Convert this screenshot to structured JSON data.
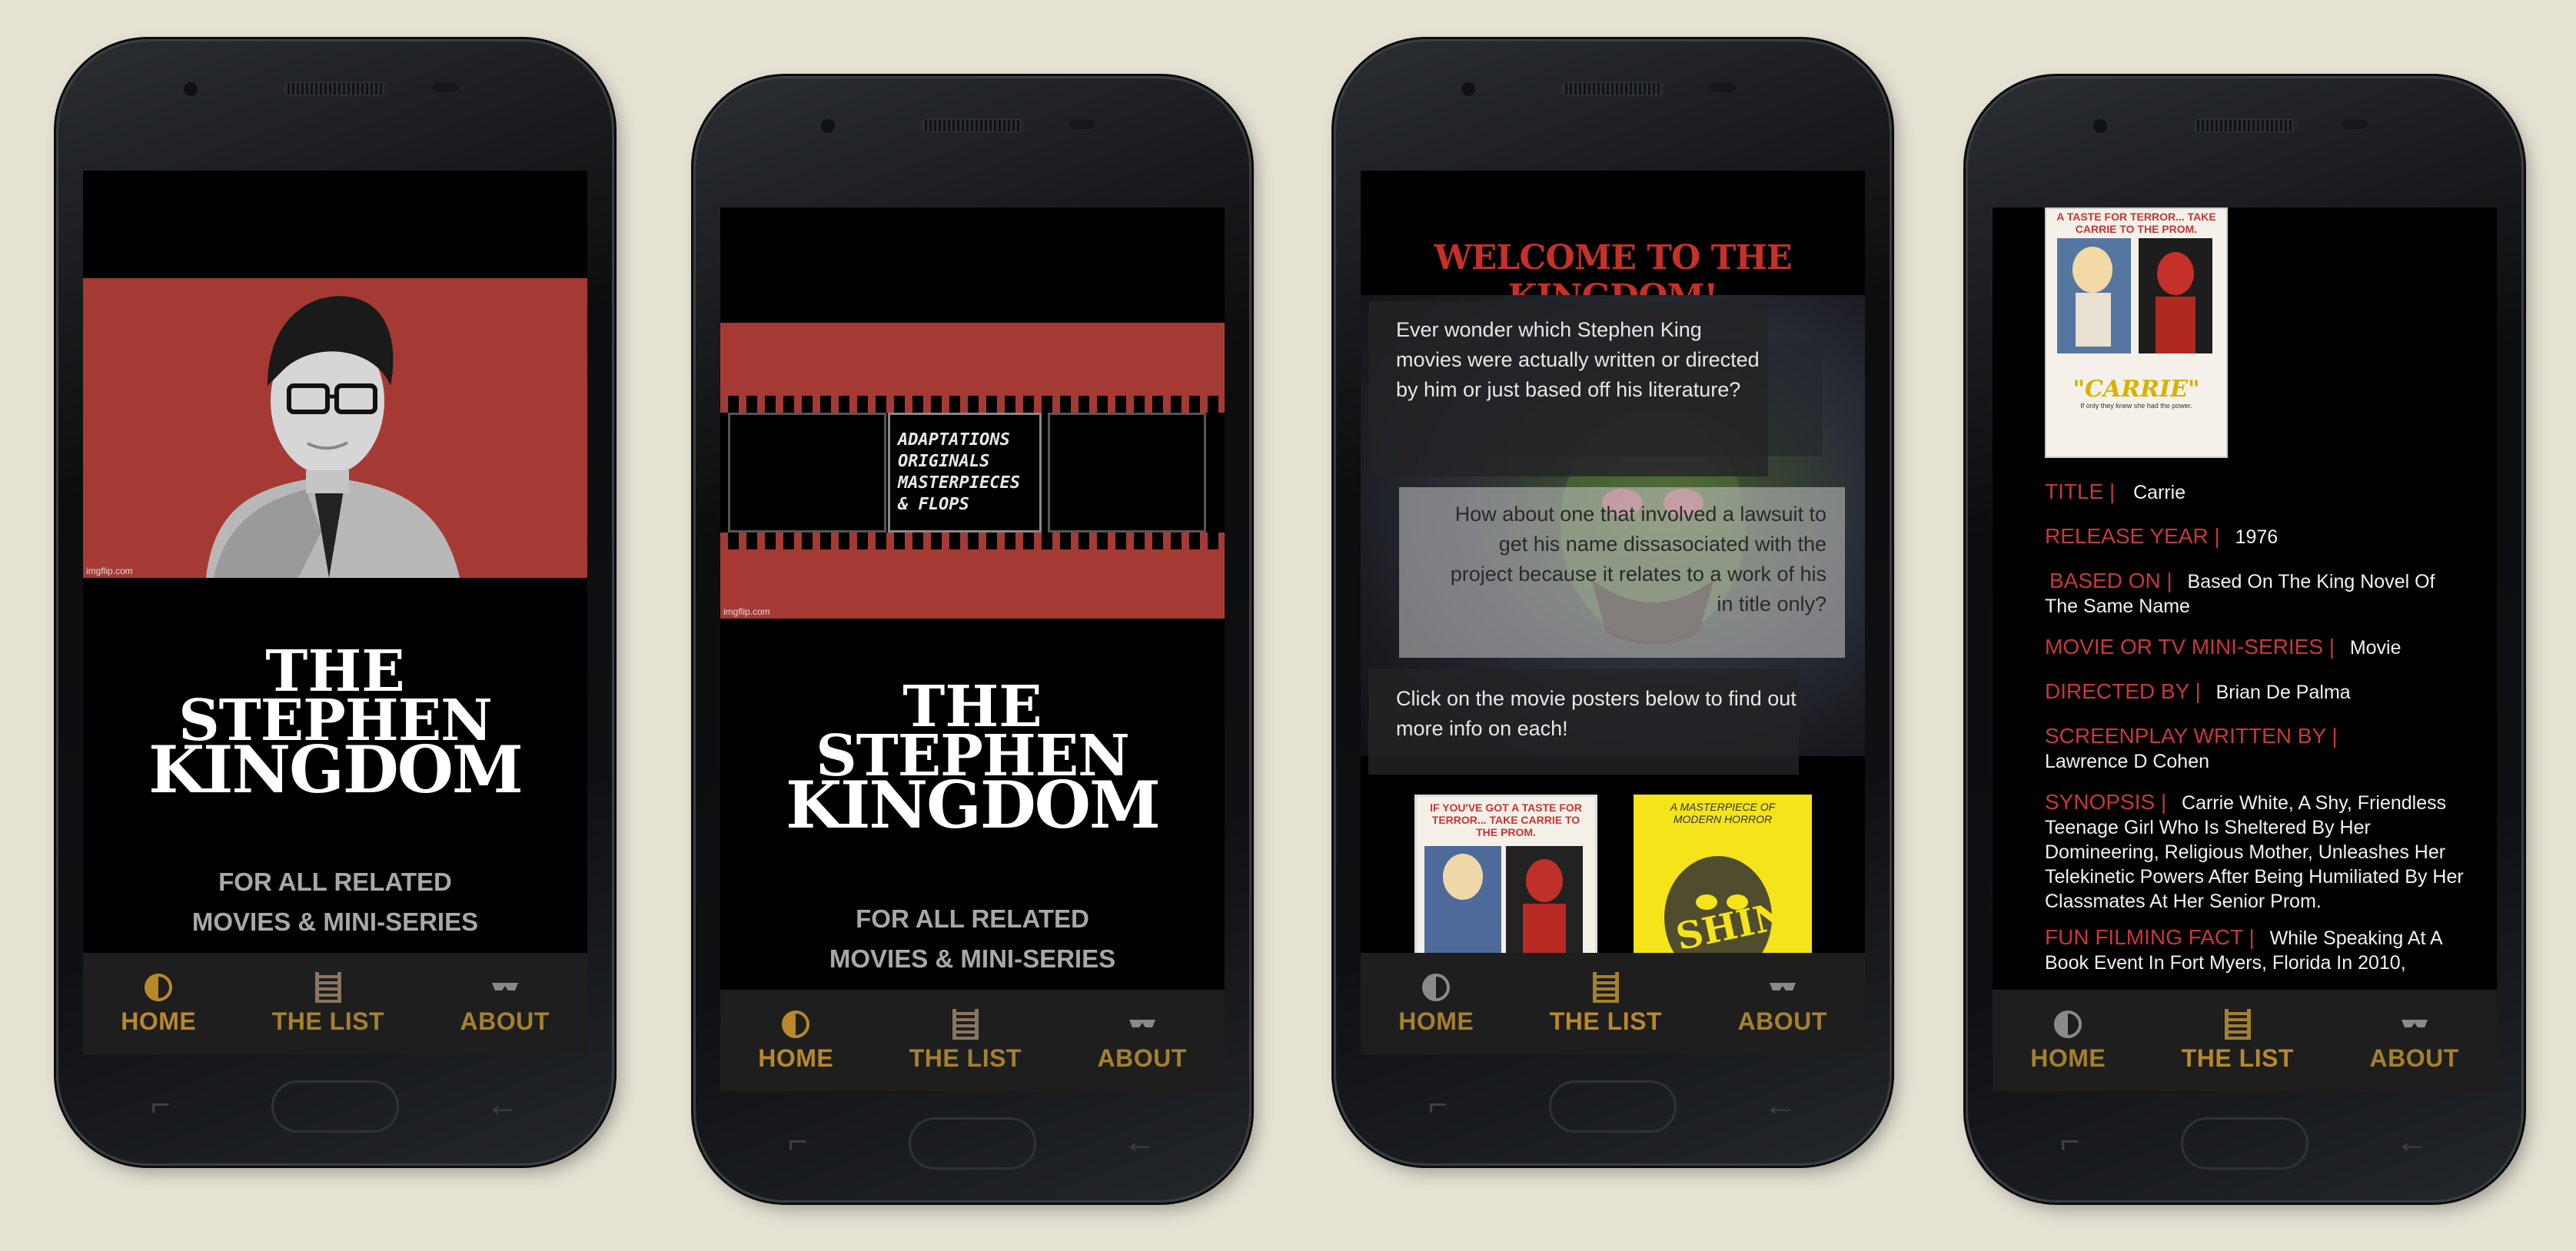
{
  "app": {
    "logo_line1": "THE",
    "logo_line2": "STEPHEN",
    "logo_line3": "KINGDOM",
    "tagline_line1": "FOR ALL RELATED",
    "tagline_line2": "MOVIES & MINI-SERIES",
    "credit": "imgflip.com",
    "accent_color": "#a4812e",
    "brand_red": "#a53a35"
  },
  "tabs": [
    {
      "label": "HOME",
      "icon": "half-circle-icon"
    },
    {
      "label": "THE LIST",
      "icon": "film-icon"
    },
    {
      "label": "ABOUT",
      "icon": "sunglasses-icon"
    }
  ],
  "screen2": {
    "filmstrip_lines": [
      "ADAPTATIONS",
      "ORIGINALS",
      "MASTERPIECES",
      "& FLOPS"
    ]
  },
  "screen3": {
    "welcome": "WELCOME TO THE KINGDOM!",
    "intro": "Ever wonder which Stephen King movies were actually written or directed by him or just based off his literature?",
    "question": "How about one that involved a lawsuit to get his name dissasociated with the project because it relates to a work of his in title only?",
    "cta": "Click on the movie posters below to find out more info on each!",
    "poster1_top": "IF YOU'VE GOT A TASTE FOR TERROR... TAKE CARRIE TO THE PROM.",
    "poster2_top": "A MASTERPIECE OF MODERN HORROR",
    "poster2_title": "THE SHINING"
  },
  "screen4": {
    "poster_top": "A TASTE FOR TERROR... TAKE CARRIE TO THE PROM.",
    "poster_title": "\"CARRIE\"",
    "poster_small": "If only they knew she had the power.",
    "title_k": "TITLE",
    "title_v": "Carrie",
    "year_k": "RELEASE YEAR",
    "year_v": "1976",
    "based_k": "BASED ON",
    "based_v": "Based On The King Novel Of The Same Name",
    "type_k": "MOVIE OR TV MINI-SERIES",
    "type_v": "Movie",
    "dir_k": "DIRECTED BY",
    "dir_v": "Brian De Palma",
    "sp_k": "SCREENPLAY WRITTEN BY",
    "sp_v": "Lawrence D Cohen",
    "syn_k": "SYNOPSIS",
    "syn_v": "Carrie White, A Shy, Friendless Teenage Girl Who Is Sheltered By Her Domineering, Religious Mother, Unleashes Her Telekinetic Powers After Being Humiliated By Her Classmates At Her Senior Prom.",
    "fun_k": "FUN FILMING FACT",
    "fun_v": "While Speaking At A Book Event In Fort Myers, Florida In 2010,"
  }
}
